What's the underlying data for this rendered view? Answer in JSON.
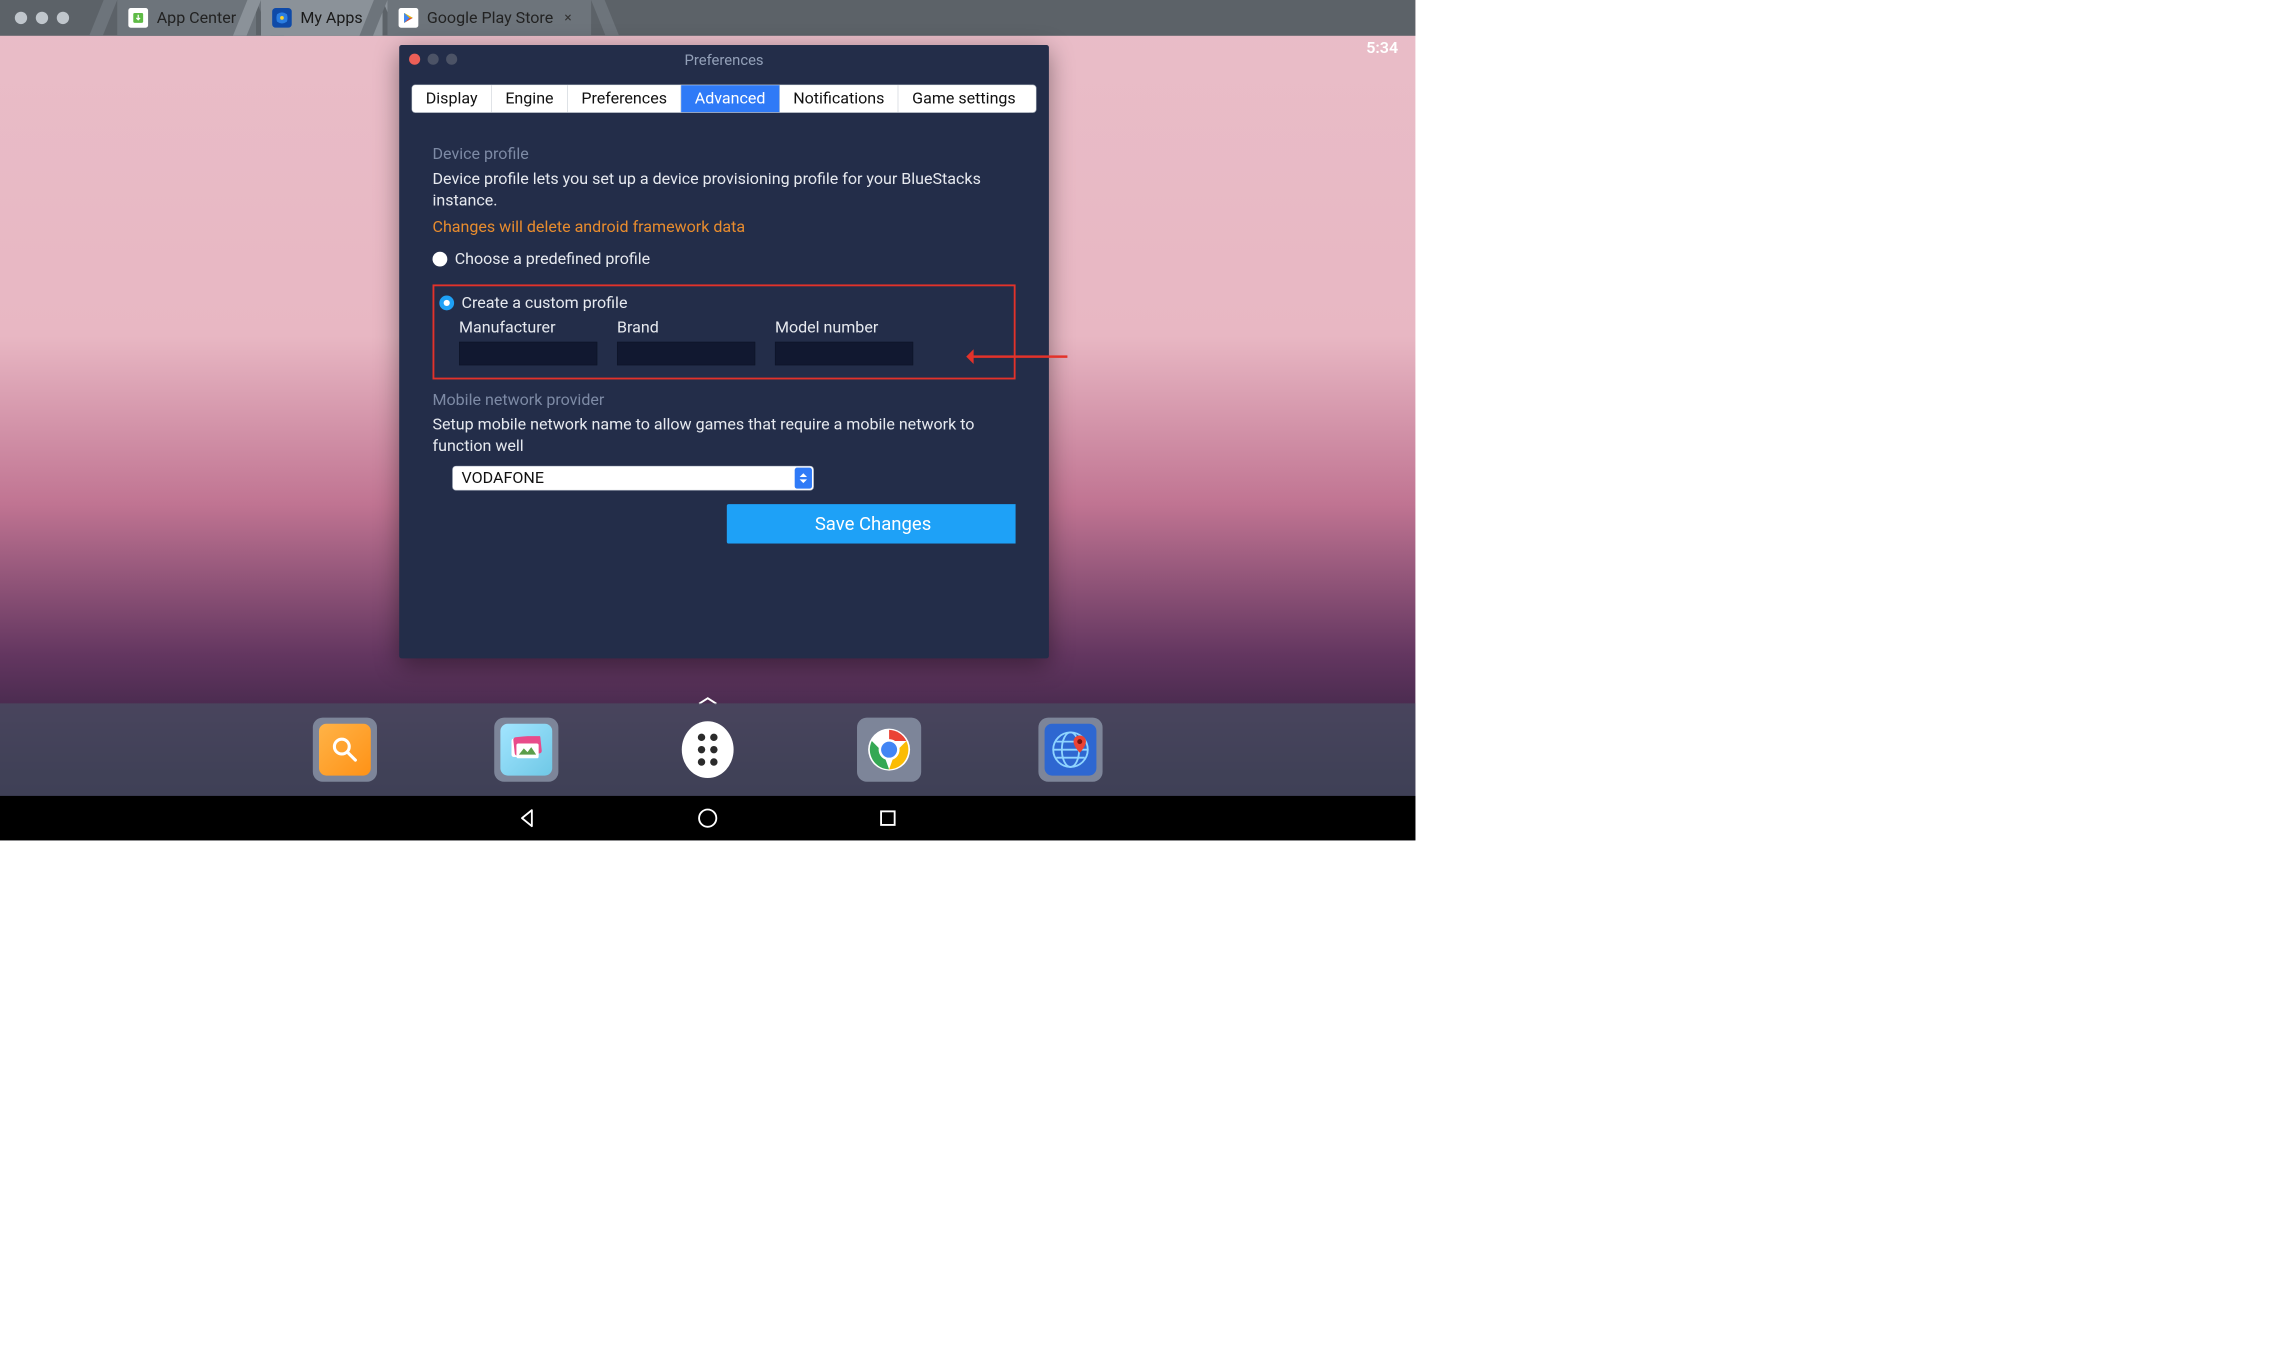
{
  "titlebar": {
    "tabs": [
      {
        "label": "App Center",
        "active": false,
        "closable": false
      },
      {
        "label": "My Apps",
        "active": true,
        "closable": false
      },
      {
        "label": "Google Play Store",
        "active": false,
        "closable": true
      }
    ]
  },
  "status": {
    "clock": "5:34"
  },
  "prefs": {
    "title": "Preferences",
    "tabs": [
      "Display",
      "Engine",
      "Preferences",
      "Advanced",
      "Notifications",
      "Game settings"
    ],
    "active_tab": "Advanced",
    "device_profile": {
      "heading": "Device profile",
      "desc": "Device profile lets you set up a device provisioning profile for your BlueStacks instance.",
      "warning": "Changes will delete android framework data",
      "option_predefined": "Choose a predefined profile",
      "option_custom": "Create a custom profile",
      "selected": "custom",
      "fields": {
        "manufacturer_label": "Manufacturer",
        "brand_label": "Brand",
        "model_label": "Model number",
        "manufacturer": "",
        "brand": "",
        "model": ""
      }
    },
    "network": {
      "heading": "Mobile network provider",
      "desc": "Setup mobile network name to allow games that require a mobile network to function well",
      "selected": "VODAFONE"
    },
    "save_label": "Save Changes"
  },
  "dock": {
    "items": [
      "search",
      "wallpaper",
      "apps",
      "chrome",
      "maps"
    ]
  }
}
